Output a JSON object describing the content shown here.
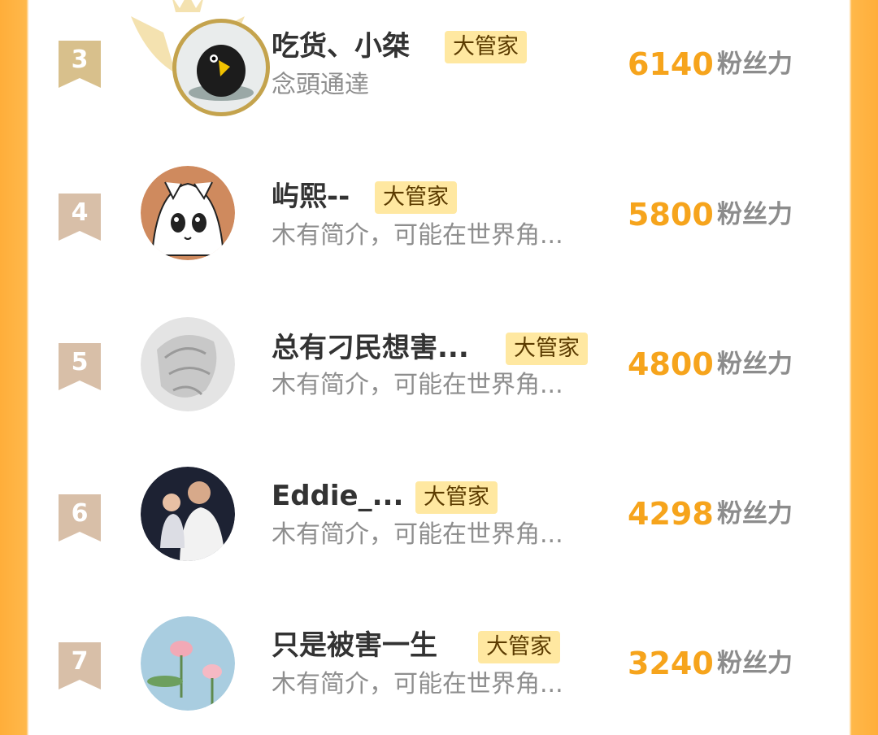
{
  "leaderboard": [
    {
      "rank": "3",
      "name": "吃货、小桀",
      "role": "大管家",
      "bio": "念頭通達",
      "score": "6140",
      "unit": "粉丝力",
      "avatar": "black-bird-avatar"
    },
    {
      "rank": "4",
      "name": "屿熙--",
      "role": "大管家",
      "bio": "木有简介，可能在世界角...",
      "score": "5800",
      "unit": "粉丝力",
      "avatar": "anime-girl-avatar"
    },
    {
      "rank": "5",
      "name": "总有刁民想害...",
      "role": "大管家",
      "bio": "木有简介，可能在世界角...",
      "score": "4800",
      "unit": "粉丝力",
      "avatar": "sketch-art-avatar"
    },
    {
      "rank": "6",
      "name": "Eddie_...",
      "role": "大管家",
      "bio": "木有简介，可能在世界角...",
      "score": "4298",
      "unit": "粉丝力",
      "avatar": "family-photo-avatar"
    },
    {
      "rank": "7",
      "name": "只是被害一生",
      "role": "大管家",
      "bio": "木有简介，可能在世界角...",
      "score": "3240",
      "unit": "粉丝力",
      "avatar": "lotus-flower-avatar"
    }
  ],
  "colors": {
    "accent": "#f6a41c",
    "badge_bg": "#ffe8a1",
    "rank_ribbon": "#d4b896",
    "side_bar": "#ffae3a"
  }
}
